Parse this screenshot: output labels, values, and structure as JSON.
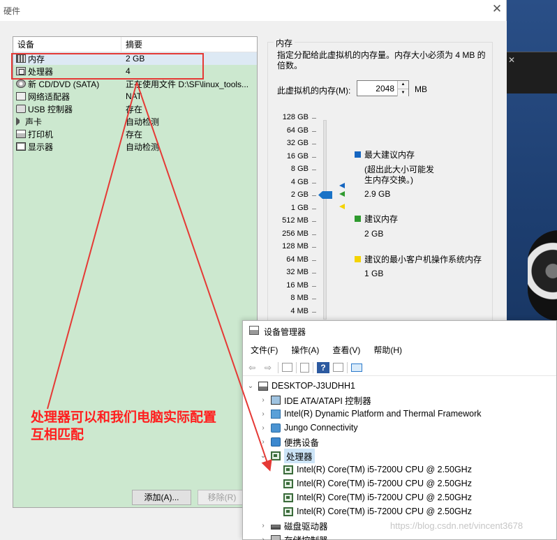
{
  "dialog": {
    "title": "硬件",
    "close_glyph": "✕"
  },
  "device_list": {
    "headers": {
      "device": "设备",
      "summary": "摘要"
    },
    "rows": [
      {
        "icon": "memory-icon",
        "name": "内存",
        "summary": "2 GB"
      },
      {
        "icon": "processor-icon",
        "name": "处理器",
        "summary": "4"
      },
      {
        "icon": "cd-dvd-icon",
        "name": "新 CD/DVD (SATA)",
        "summary": "正在使用文件 D:\\SF\\linux_tools..."
      },
      {
        "icon": "network-adapter-icon",
        "name": "网络适配器",
        "summary": "NAT"
      },
      {
        "icon": "usb-icon",
        "name": "USB 控制器",
        "summary": "存在"
      },
      {
        "icon": "sound-icon",
        "name": "声卡",
        "summary": "自动检测"
      },
      {
        "icon": "printer-icon",
        "name": "打印机",
        "summary": "存在"
      },
      {
        "icon": "display-icon",
        "name": "显示器",
        "summary": "自动检测"
      }
    ],
    "add_label": "添加(A)...",
    "remove_label": "移除(R)"
  },
  "memory": {
    "group_title": "内存",
    "description": "指定分配给此虚拟机的内存量。内存大小必须为 4 MB 的倍数。",
    "field_label": "此虚拟机的内存(M):",
    "value": "2048",
    "unit": "MB",
    "scale": [
      "128 GB",
      "64 GB",
      "32 GB",
      "16 GB",
      "8 GB",
      "4 GB",
      "2 GB",
      "1 GB",
      "512 MB",
      "256 MB",
      "128 MB",
      "64 MB",
      "32 MB",
      "16 MB",
      "8 MB",
      "4 MB"
    ],
    "legend": {
      "max": {
        "color": "#1565c0",
        "title": "最大建议内存",
        "note": "(超出此大小可能发生内存交换。)",
        "value": "2.9 GB"
      },
      "recommended": {
        "color": "#2e9a2e",
        "title": "建议内存",
        "value": "2 GB"
      },
      "min": {
        "color": "#f4d300",
        "title": "建议的最小客户机操作系统内存",
        "value": "1 GB"
      }
    }
  },
  "device_manager": {
    "title": "设备管理器",
    "menu": [
      "文件(F)",
      "操作(A)",
      "查看(V)",
      "帮助(H)"
    ],
    "toolbar": [
      "back-icon",
      "forward-icon",
      "properties-icon",
      "device-list-icon",
      "help-icon",
      "scan-icon",
      "monitor-icon"
    ],
    "tree": {
      "root": "DESKTOP-J3UDHH1",
      "nodes": [
        {
          "label": "IDE ATA/ATAPI 控制器",
          "icon": "ide-controller-icon"
        },
        {
          "label": "Intel(R) Dynamic Platform and Thermal Framework",
          "icon": "intel-framework-icon"
        },
        {
          "label": "Jungo Connectivity",
          "icon": "jungo-icon"
        },
        {
          "label": "便携设备",
          "icon": "portable-device-icon"
        }
      ],
      "processor_node": "处理器",
      "processors": [
        "Intel(R) Core(TM) i5-7200U CPU @ 2.50GHz",
        "Intel(R) Core(TM) i5-7200U CPU @ 2.50GHz",
        "Intel(R) Core(TM) i5-7200U CPU @ 2.50GHz",
        "Intel(R) Core(TM) i5-7200U CPU @ 2.50GHz"
      ],
      "after": [
        {
          "label": "磁盘驱动器",
          "icon": "disk-drive-icon"
        },
        {
          "label": "存储控制器",
          "icon": "storage-controller-icon"
        }
      ]
    }
  },
  "annotation": {
    "line1": "处理器可以和我们电脑实际配置",
    "line2": "互相匹配",
    "color": "#ff1e1e"
  },
  "watermark": "https://blog.csdn.net/vincent3678"
}
